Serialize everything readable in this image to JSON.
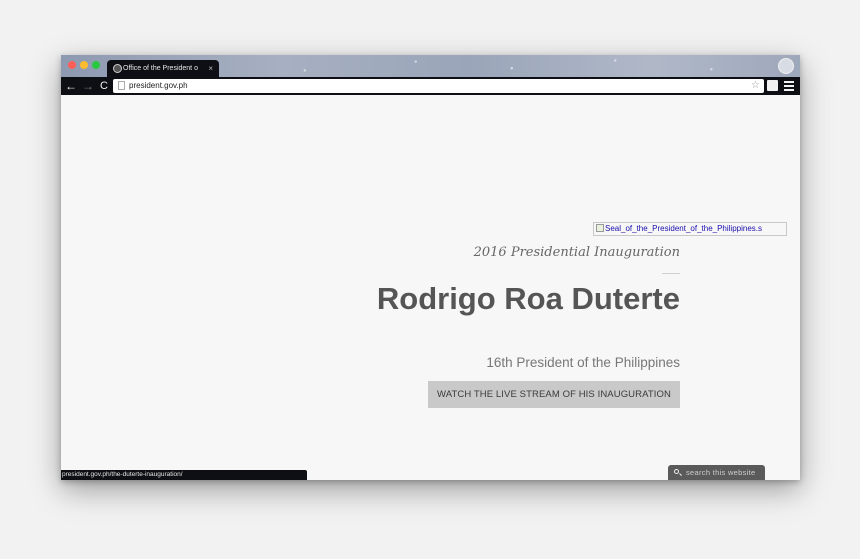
{
  "browser": {
    "tab_title": "Office of the President o",
    "tab_close": "×",
    "url": "president.gov.ph",
    "status_url": "president.gov.ph/the-duterte-inauguration/",
    "nav": {
      "back": "←",
      "forward": "→",
      "reload": "C"
    },
    "bookmark_star": "☆",
    "colors": {
      "chrome_dark": "#0d0f14",
      "close": "#fc5f57",
      "minimize": "#fdbc2e",
      "zoom": "#28c840"
    }
  },
  "page": {
    "seal_alt": "Seal_of_the_President_of_the_Philippines.s",
    "event": "2016 Presidential Inauguration",
    "name": "Rodrigo Roa Duterte",
    "role": "16th President of the Philippines",
    "cta_label": "WATCH THE LIVE STREAM OF HIS INAUGURATION",
    "search_placeholder": "search this website"
  }
}
